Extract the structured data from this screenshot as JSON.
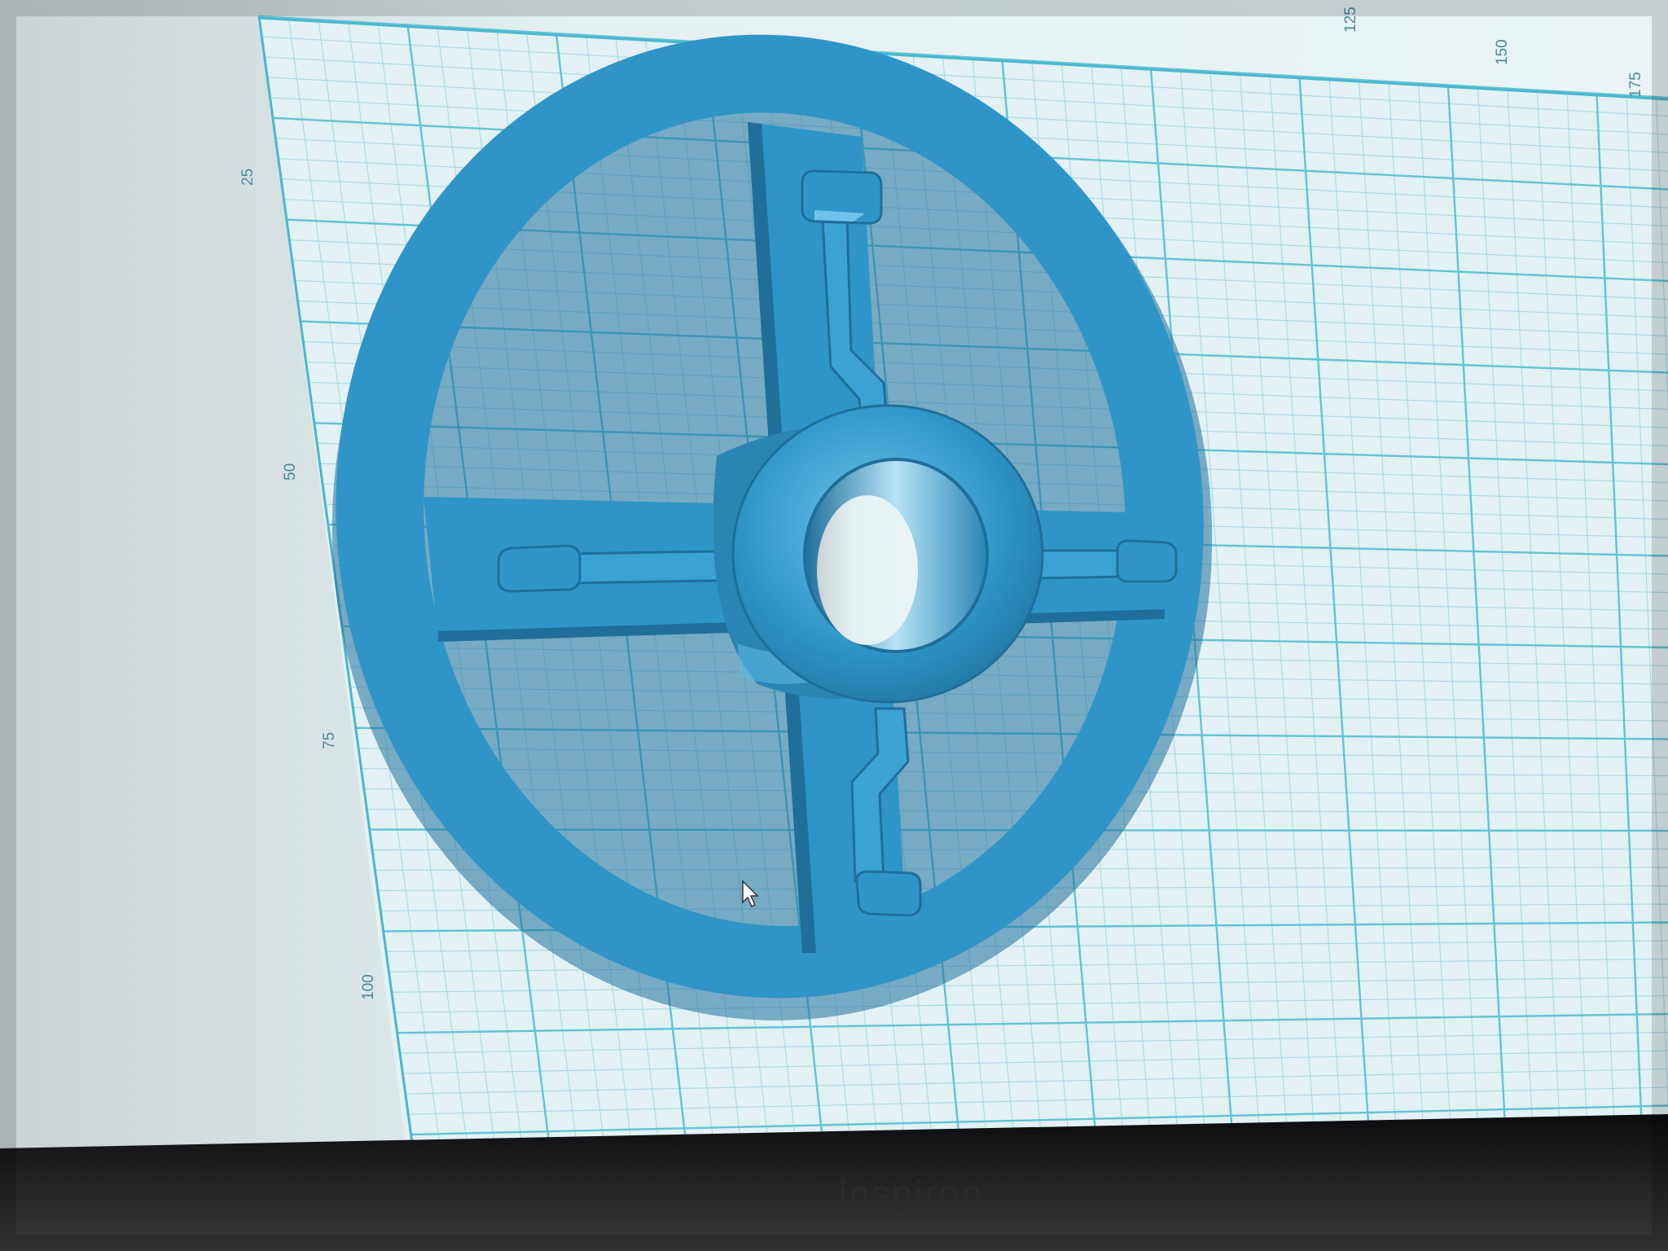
{
  "viewport": {
    "grid_labels_top": [
      "125",
      "150",
      "175"
    ],
    "grid_labels_left": [
      "25",
      "50",
      "75",
      "100"
    ]
  },
  "model": {
    "color": "#2f95c8",
    "shade_color": "#1f6f9a",
    "highlight_color": "#6fc3ea"
  },
  "grid": {
    "major_color": "#5fc4d6",
    "minor_color": "#a9dde6",
    "background_color": "#e9f3f5"
  },
  "cursor": {
    "icon": "mouse-pointer-icon"
  },
  "laptop": {
    "brand": "inspiron"
  }
}
